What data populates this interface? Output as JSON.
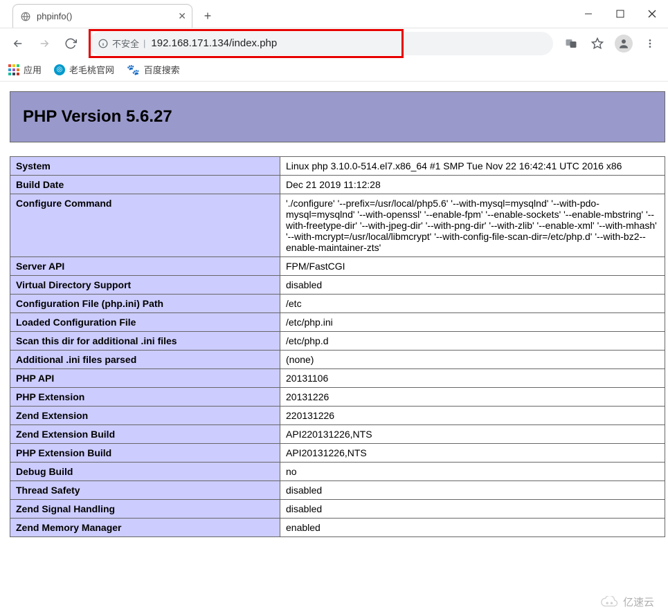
{
  "window": {
    "tab_title": "phpinfo()"
  },
  "addressbar": {
    "security_label": "不安全",
    "url": "192.168.171.134/index.php"
  },
  "bookmarks": {
    "apps": "应用",
    "bm1": "老毛桃官网",
    "bm2": "百度搜索"
  },
  "php": {
    "header": "PHP Version 5.6.27",
    "rows": [
      {
        "k": "System",
        "v": "Linux php 3.10.0-514.el7.x86_64 #1 SMP Tue Nov 22 16:42:41 UTC 2016 x86"
      },
      {
        "k": "Build Date",
        "v": "Dec 21 2019 11:12:28"
      },
      {
        "k": "Configure Command",
        "v": "'./configure' '--prefix=/usr/local/php5.6' '--with-mysql=mysqlnd' '--with-pdo-mysql=mysqlnd' '--with-openssl' '--enable-fpm' '--enable-sockets' '--enable-mbstring' '--with-freetype-dir' '--with-jpeg-dir' '--with-png-dir' '--with-zlib' '--enable-xml' '--with-mhash' '--with-mcrypt=/usr/local/libmcrypt' '--with-config-file-scan-dir=/etc/php.d' '--with-bz2--enable-maintainer-zts'"
      },
      {
        "k": "Server API",
        "v": "FPM/FastCGI"
      },
      {
        "k": "Virtual Directory Support",
        "v": "disabled"
      },
      {
        "k": "Configuration File (php.ini) Path",
        "v": "/etc"
      },
      {
        "k": "Loaded Configuration File",
        "v": "/etc/php.ini"
      },
      {
        "k": "Scan this dir for additional .ini files",
        "v": "/etc/php.d"
      },
      {
        "k": "Additional .ini files parsed",
        "v": "(none)"
      },
      {
        "k": "PHP API",
        "v": "20131106"
      },
      {
        "k": "PHP Extension",
        "v": "20131226"
      },
      {
        "k": "Zend Extension",
        "v": "220131226"
      },
      {
        "k": "Zend Extension Build",
        "v": "API220131226,NTS"
      },
      {
        "k": "PHP Extension Build",
        "v": "API20131226,NTS"
      },
      {
        "k": "Debug Build",
        "v": "no"
      },
      {
        "k": "Thread Safety",
        "v": "disabled"
      },
      {
        "k": "Zend Signal Handling",
        "v": "disabled"
      },
      {
        "k": "Zend Memory Manager",
        "v": "enabled"
      }
    ]
  },
  "watermark": "亿速云"
}
